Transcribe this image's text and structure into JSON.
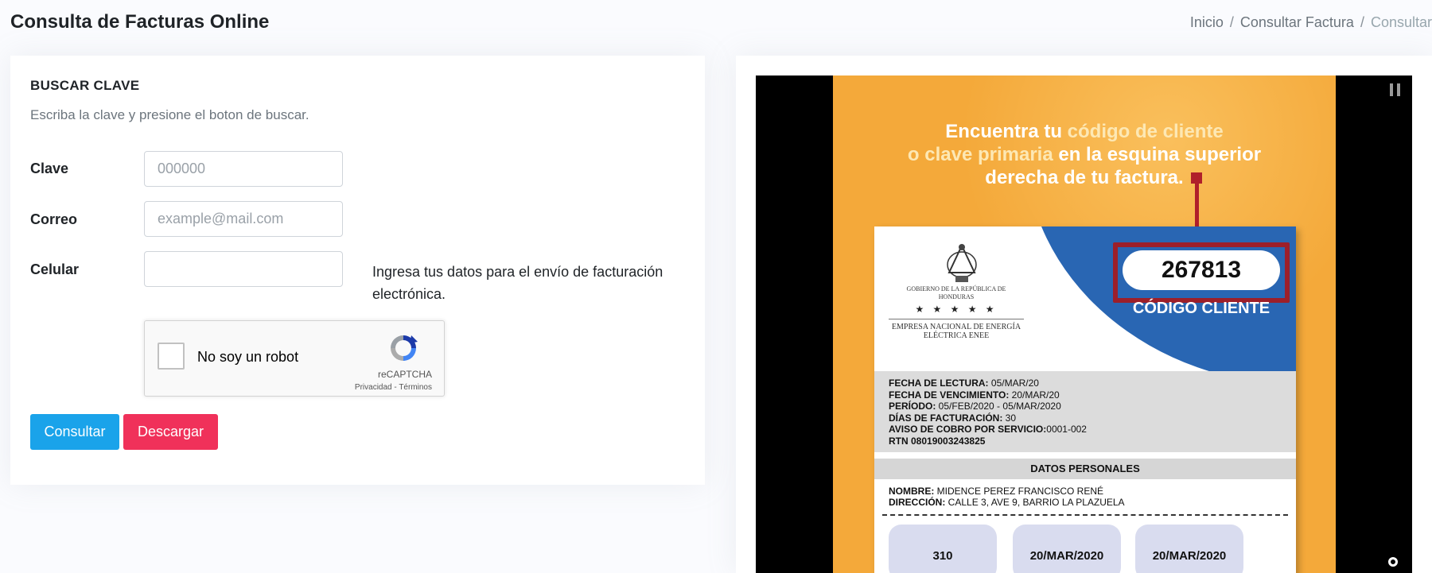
{
  "header": {
    "title": "Consulta de Facturas Online",
    "breadcrumb": [
      "Inicio",
      "Consultar Factura",
      "Consultar"
    ]
  },
  "search_card": {
    "title": "BUSCAR CLAVE",
    "subtitle": "Escriba la clave y presione el boton de buscar.",
    "fields": {
      "clave": {
        "label": "Clave",
        "placeholder": "000000",
        "value": ""
      },
      "correo": {
        "label": "Correo",
        "placeholder": "example@mail.com",
        "value": ""
      },
      "celular": {
        "label": "Celular",
        "placeholder": "",
        "value": ""
      }
    },
    "hint": "Ingresa tus datos para el envío de facturación electrónica.",
    "captcha": {
      "label": "No soy un robot",
      "brand": "reCAPTCHA",
      "links": "Privacidad - Términos"
    },
    "buttons": {
      "consultar": "Consultar",
      "descargar": "Descargar"
    },
    "colors": {
      "consultar": "#1aa3ea",
      "descargar": "#f0315a"
    }
  },
  "video": {
    "promo_lines": [
      {
        "a": "Encuentra tu ",
        "b": "código de cliente"
      },
      {
        "a": "o clave primaria ",
        "b": "en la esquina superior"
      },
      {
        "a": "derecha de tu factura.",
        "b": ""
      }
    ],
    "bill": {
      "code": "267813",
      "code_label": "CÓDIGO CLIENTE",
      "gov": "GOBIERNO DE LA REPÚBLICA DE HONDURAS",
      "stars": "★ ★ ★ ★ ★",
      "company": "EMPRESA NACIONAL DE ENERGÍA ELÉCTRICA ENEE",
      "info": [
        {
          "k": "FECHA DE LECTURA:",
          "v": " 05/MAR/20"
        },
        {
          "k": "FECHA DE VENCIMIENTO:",
          "v": " 20/MAR/20"
        },
        {
          "k": "PERÍODO:",
          "v": " 05/FEB/2020 - 05/MAR/2020"
        },
        {
          "k": "DÍAS DE FACTURACIÓN:",
          "v": " 30"
        },
        {
          "k": "AVISO DE COBRO POR SERVICIO:",
          "v": "0001-002"
        },
        {
          "k": "RTN 08019003243825",
          "v": ""
        }
      ],
      "datos_title": "DATOS PERSONALES",
      "nombre_k": "NOMBRE:",
      "nombre_v": " MIDENCE PEREZ FRANCISCO RENÉ",
      "direccion_k": "DIRECCIÓN:",
      "direccion_v": " CALLE 3, AVE 9, BARRIO LA PLAZUELA",
      "pills": [
        "310",
        "20/MAR/2020",
        "20/MAR/2020"
      ]
    },
    "colors": {
      "frame": "#f4a93a",
      "bill_blue": "#2966b3",
      "highlight_red": "#9c1f2a"
    }
  },
  "icons": {
    "pause": "pause-icon",
    "indicator": "circle-indicator-icon",
    "recaptcha": "recaptcha-logo-icon",
    "seal": "coat-of-arms-icon"
  }
}
